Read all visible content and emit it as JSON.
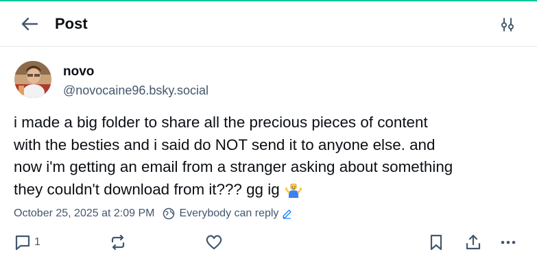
{
  "header": {
    "title": "Post",
    "back_icon": "arrow-left-icon",
    "settings_icon": "sliders-icon"
  },
  "post": {
    "author": {
      "display_name": "novo",
      "handle": "@novocaine96.bsky.social"
    },
    "text": "i made a big folder to share all the precious pieces of content\nwith the besties and i said do NOT send it to anyone else. and\nnow i'm getting an email from a stranger asking about something\nthey couldn't download from it??? gg ig",
    "emoji": "person-shrugging-emoji",
    "timestamp": "October 25, 2025 at 2:09 PM",
    "reply_setting": "Everybody can reply",
    "reply_count": "1"
  },
  "colors": {
    "accent": "#1083fe",
    "muted_text": "#42576c",
    "divider": "#e3e7ec",
    "top_border": "#00c59a"
  }
}
